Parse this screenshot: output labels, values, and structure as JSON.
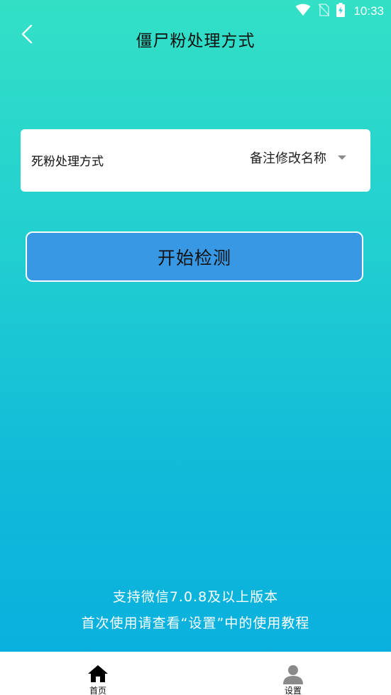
{
  "status_bar": {
    "time": "10:33",
    "icons": [
      "wifi-icon",
      "no-sim-icon",
      "battery-charging-icon"
    ]
  },
  "header": {
    "title": "僵尸粉处理方式",
    "back_icon": "back-chevron-icon"
  },
  "setting": {
    "label": "死粉处理方式",
    "value": "备注修改名称"
  },
  "start_button": {
    "label": "开始检测"
  },
  "notes": {
    "line1": "支持微信7.0.8及以上版本",
    "line2": "首次使用请查看“设置”中的使用教程"
  },
  "bottom_nav": {
    "items": [
      {
        "label": "首页",
        "icon": "home-icon"
      },
      {
        "label": "设置",
        "icon": "user-icon"
      }
    ]
  },
  "colors": {
    "gradient_top": "#33e0c6",
    "gradient_bottom": "#07aedf",
    "button_blue": "#3898e4"
  }
}
